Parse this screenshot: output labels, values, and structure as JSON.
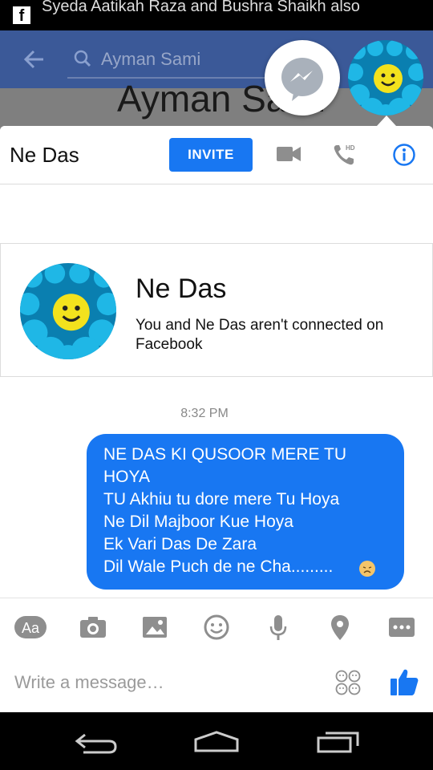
{
  "status_bar": {
    "notification_text": "Syeda Aatikah Raza and Bushra Shaikh also",
    "notification_text_line2": "...... ...... ..",
    "app_icon": "facebook-icon"
  },
  "background_page": {
    "search_value": "Ayman Sami",
    "profile_name": "Ayman Sami"
  },
  "chat_header": {
    "contact_name": "Ne Das",
    "invite_label": "INVITE",
    "icons": [
      "video-camera-icon",
      "hd-phone-icon",
      "info-icon"
    ]
  },
  "profile_card": {
    "name": "Ne Das",
    "description": "You and Ne Das aren't connected on Facebook"
  },
  "conversation": {
    "timestamp": "8:32 PM",
    "messages": [
      {
        "text": "NE DAS KI QUSOOR MERE TU\nHOYA\nTU Akhiu tu dore mere Tu Hoya\nNe Dil Majboor Kue Hoya\nEk Vari Das De Zara\nDil Wale Puch de ne Cha.........",
        "emoji": "disappointed-face-emoji"
      }
    ]
  },
  "toolbar": {
    "items": [
      "text-style-icon",
      "camera-icon",
      "gallery-icon",
      "emoji-icon",
      "microphone-icon",
      "location-icon",
      "more-icon"
    ],
    "text_style_label": "Aa"
  },
  "composer": {
    "placeholder": "Write a message…"
  },
  "colors": {
    "accent": "#1877f2",
    "facebook_header": "#3b5998",
    "icon_gray": "#8e8e8e"
  }
}
